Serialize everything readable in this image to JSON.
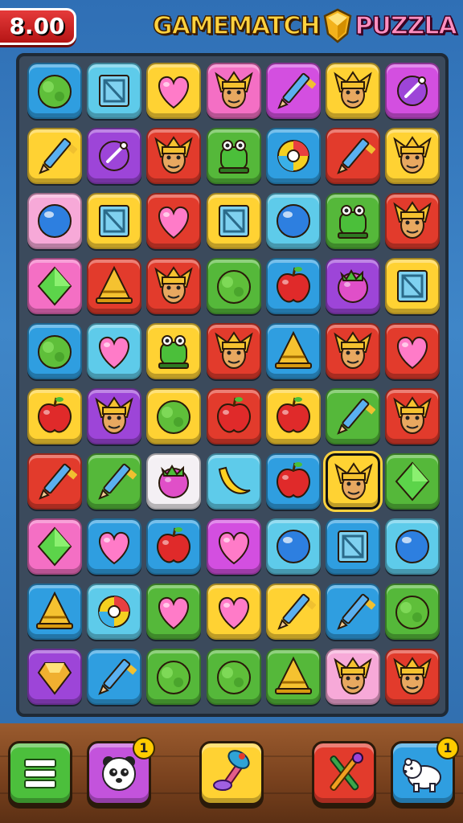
{
  "hud": {
    "score": "8.00",
    "title_part1": "GAMEMATCH",
    "title_part2": "PUZZLA"
  },
  "colors": {
    "blue": "#2f9ee0",
    "cyan": "#5ecbea",
    "yellow": "#ffd233",
    "orange": "#ffab2e",
    "pink": "#f46fc4",
    "magenta": "#d34fe0",
    "purple": "#9d45d8",
    "red": "#e23b2c",
    "green": "#55b83a",
    "lime": "#9bd43a",
    "white": "#f4f0f4",
    "lightpink": "#f7a9d8"
  },
  "board": {
    "rows": [
      [
        [
          "blue",
          "bush"
        ],
        [
          "cyan",
          "crate"
        ],
        [
          "yellow",
          "heart"
        ],
        [
          "pink",
          "mask"
        ],
        [
          "magenta",
          "pencil"
        ],
        [
          "yellow",
          "mask"
        ],
        [
          "magenta",
          "swirl"
        ]
      ],
      [
        [
          "yellow",
          "pencil"
        ],
        [
          "purple",
          "swirl"
        ],
        [
          "red",
          "mask"
        ],
        [
          "green",
          "frog"
        ],
        [
          "blue",
          "candy"
        ],
        [
          "red",
          "pencil"
        ],
        [
          "yellow",
          "mask"
        ]
      ],
      [
        [
          "lightpink",
          "orb"
        ],
        [
          "yellow",
          "crate"
        ],
        [
          "red",
          "heart"
        ],
        [
          "yellow",
          "crate"
        ],
        [
          "cyan",
          "orb"
        ],
        [
          "green",
          "frog"
        ],
        [
          "red",
          "mask"
        ]
      ],
      [
        [
          "pink",
          "diamond"
        ],
        [
          "red",
          "cone"
        ],
        [
          "red",
          "mask"
        ],
        [
          "green",
          "bush"
        ],
        [
          "blue",
          "apple"
        ],
        [
          "purple",
          "berry"
        ],
        [
          "yellow",
          "crate"
        ]
      ],
      [
        [
          "blue",
          "bush"
        ],
        [
          "cyan",
          "heart"
        ],
        [
          "yellow",
          "frog"
        ],
        [
          "red",
          "mask"
        ],
        [
          "blue",
          "cone"
        ],
        [
          "red",
          "mask"
        ],
        [
          "red",
          "heart"
        ]
      ],
      [
        [
          "yellow",
          "apple"
        ],
        [
          "purple",
          "mask"
        ],
        [
          "yellow",
          "bush"
        ],
        [
          "red",
          "apple"
        ],
        [
          "yellow",
          "apple"
        ],
        [
          "green",
          "pencil"
        ],
        [
          "red",
          "mask"
        ]
      ],
      [
        [
          "red",
          "pencil"
        ],
        [
          "green",
          "pencil"
        ],
        [
          "white",
          "berry"
        ],
        [
          "cyan",
          "banana"
        ],
        [
          "blue",
          "apple"
        ],
        [
          "yellow",
          "mask"
        ],
        [
          "green",
          "diamond"
        ]
      ],
      [
        [
          "pink",
          "diamond"
        ],
        [
          "blue",
          "heart"
        ],
        [
          "blue",
          "apple"
        ],
        [
          "magenta",
          "heart"
        ],
        [
          "cyan",
          "orb"
        ],
        [
          "blue",
          "crate"
        ],
        [
          "cyan",
          "orb"
        ]
      ],
      [
        [
          "blue",
          "cone"
        ],
        [
          "cyan",
          "candy"
        ],
        [
          "green",
          "heart"
        ],
        [
          "yellow",
          "heart"
        ],
        [
          "yellow",
          "pencil"
        ],
        [
          "blue",
          "pencil"
        ],
        [
          "green",
          "bush"
        ]
      ],
      [
        [
          "purple",
          "gem"
        ],
        [
          "blue",
          "pencil"
        ],
        [
          "green",
          "bush"
        ],
        [
          "green",
          "bush"
        ],
        [
          "green",
          "cone"
        ],
        [
          "lightpink",
          "mask"
        ],
        [
          "red",
          "mask"
        ]
      ]
    ],
    "selected": [
      6,
      5
    ]
  },
  "toolbar": {
    "menu_color": "#4cbf3c",
    "panda_color": "#c353dc",
    "panda_badge": "1",
    "hammer_color": "#ffd233",
    "shuffle_color": "#e23b2c",
    "bear_color": "#2f9ee0",
    "bear_badge": "1"
  }
}
